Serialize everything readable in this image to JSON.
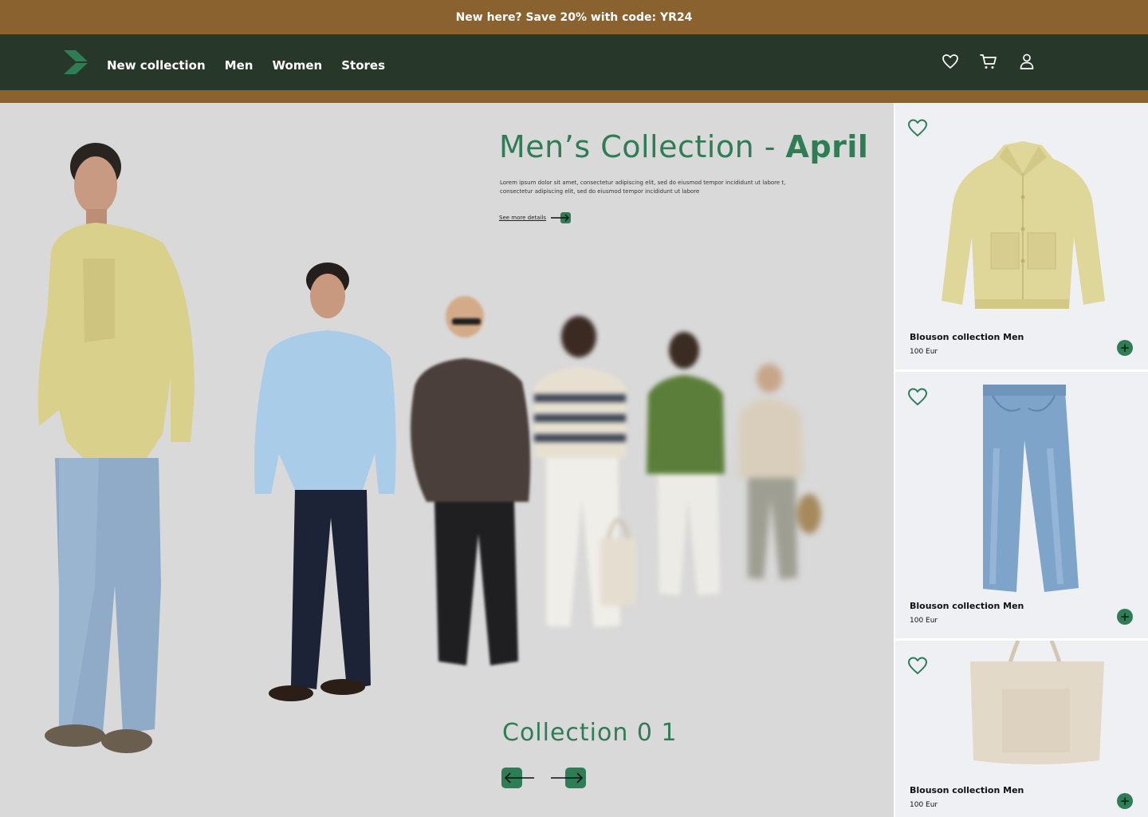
{
  "promo": {
    "text": "New here? Save 20% with code: YR24"
  },
  "nav": {
    "links": [
      "New collection",
      "Men",
      "Women",
      "Stores"
    ],
    "icons": [
      "heart-icon",
      "cart-icon",
      "user-icon"
    ]
  },
  "hero": {
    "title_main": "Men’s Collection - ",
    "title_strong": "April",
    "description": "Lorem ipsum dolor sit amet, consectetur adipiscing elit, sed do eiusmod tempor incididunt ut labore t, consectetur adipiscing elit, sed do eiusmod tempor incididunt ut labore",
    "see_more": "See more details",
    "collection_label": "Collection 0 1"
  },
  "products": [
    {
      "name": "Blouson collection Men",
      "price": "100 Eur",
      "image": "yellow-jacket"
    },
    {
      "name": "Blouson collection Men",
      "price": "100 Eur",
      "image": "blue-jeans"
    },
    {
      "name": "Blouson collection Men",
      "price": "100 Eur",
      "image": "tote-bag"
    }
  ],
  "colors": {
    "brand_green": "#2f7d55",
    "nav_bg": "#27382b",
    "promo_bg": "#8a6230",
    "hero_bg": "#d9d9d9",
    "card_bg": "#eef0f4"
  }
}
